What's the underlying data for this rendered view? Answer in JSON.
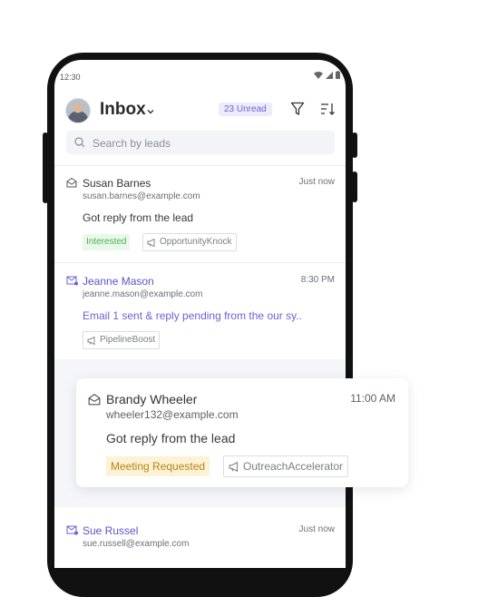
{
  "status_bar": {
    "time": "12:30"
  },
  "header": {
    "title": "Inbox",
    "unread_badge": "23 Unread"
  },
  "search": {
    "placeholder": "Search by leads"
  },
  "leads": [
    {
      "name": "Susan Barnes",
      "email": "susan.barnes@example.com",
      "time": "Just now",
      "message": "Got reply from the lead",
      "status_tag": "Interested",
      "campaign_tag": "OpportunityKnock",
      "icon": "mail-open-icon"
    },
    {
      "name": "Jeanne Mason",
      "email": "jeanne.mason@example.com",
      "time": "8:30 PM",
      "message": "Email 1 sent & reply pending from the our sy..",
      "campaign_tag": "PipelineBoost",
      "icon": "mail-unread-icon"
    },
    {
      "name": "Brandy Wheeler",
      "email": "wheeler132@example.com",
      "time": "11:00 AM",
      "message": "Got reply from the lead",
      "status_tag": "Meeting Requested",
      "campaign_tag": "OutreachAccelerator",
      "icon": "mail-open-icon"
    },
    {
      "name": "Sue Russel",
      "email": "sue.russell@example.com",
      "time": "Just now",
      "icon": "mail-unread-icon"
    }
  ],
  "colors": {
    "accent": "#5b55c9",
    "interested_bg": "#e9f8ea",
    "meeting_bg": "#fdf2d5"
  }
}
